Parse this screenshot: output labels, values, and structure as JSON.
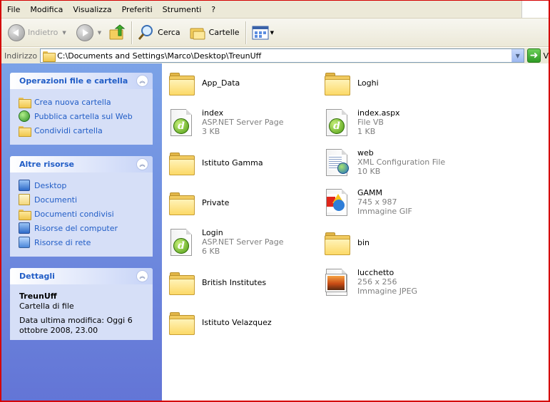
{
  "menu": [
    "File",
    "Modifica",
    "Visualizza",
    "Preferiti",
    "Strumenti",
    "?"
  ],
  "toolbar": {
    "back_label": "Indietro",
    "search_label": "Cerca",
    "folders_label": "Cartelle"
  },
  "address": {
    "label": "Indirizzo",
    "path": "C:\\Documents and Settings\\Marco\\Desktop\\TreunUff",
    "go_label": "V"
  },
  "sidebar": {
    "file_tasks": {
      "title": "Operazioni file e cartella",
      "items": [
        "Crea nuova cartella",
        "Pubblica cartella sul Web",
        "Condividi cartella"
      ]
    },
    "other_places": {
      "title": "Altre risorse",
      "items": [
        "Desktop",
        "Documenti",
        "Documenti condivisi",
        "Risorse del computer",
        "Risorse di rete"
      ]
    },
    "details": {
      "title": "Dettagli",
      "name": "TreunUff",
      "type": "Cartella di file",
      "modified_line1": "Data ultima modifica: Oggi 6",
      "modified_line2": "ottobre 2008, 23.00"
    }
  },
  "files": [
    {
      "name": "App_Data",
      "type": "",
      "size": "",
      "icon": "folder-icon"
    },
    {
      "name": "Loghi",
      "type": "",
      "size": "",
      "icon": "folder-icon"
    },
    {
      "name": "index",
      "type": "ASP.NET Server Page",
      "size": "3 KB",
      "icon": "aspx-page-icon"
    },
    {
      "name": "index.aspx",
      "type": "File VB",
      "size": "1 KB",
      "icon": "vb-file-icon"
    },
    {
      "name": "Istituto Gamma",
      "type": "",
      "size": "",
      "icon": "folder-icon"
    },
    {
      "name": "web",
      "type": "XML Configuration File",
      "size": "10 KB",
      "icon": "xml-config-icon"
    },
    {
      "name": "Private",
      "type": "",
      "size": "",
      "icon": "folder-icon"
    },
    {
      "name": "GAMM",
      "type": "745 x 987",
      "size": "Immagine GIF",
      "icon": "gif-image-icon"
    },
    {
      "name": "Login",
      "type": "ASP.NET Server Page",
      "size": "6 KB",
      "icon": "aspx-page-icon"
    },
    {
      "name": "bin",
      "type": "",
      "size": "",
      "icon": "folder-icon"
    },
    {
      "name": "British Institutes",
      "type": "",
      "size": "",
      "icon": "folder-icon"
    },
    {
      "name": "lucchetto",
      "type": "256 x 256",
      "size": "Immagine JPEG",
      "icon": "jpeg-image-icon"
    },
    {
      "name": "Istituto Velazquez",
      "type": "",
      "size": "",
      "icon": "folder-icon"
    }
  ]
}
